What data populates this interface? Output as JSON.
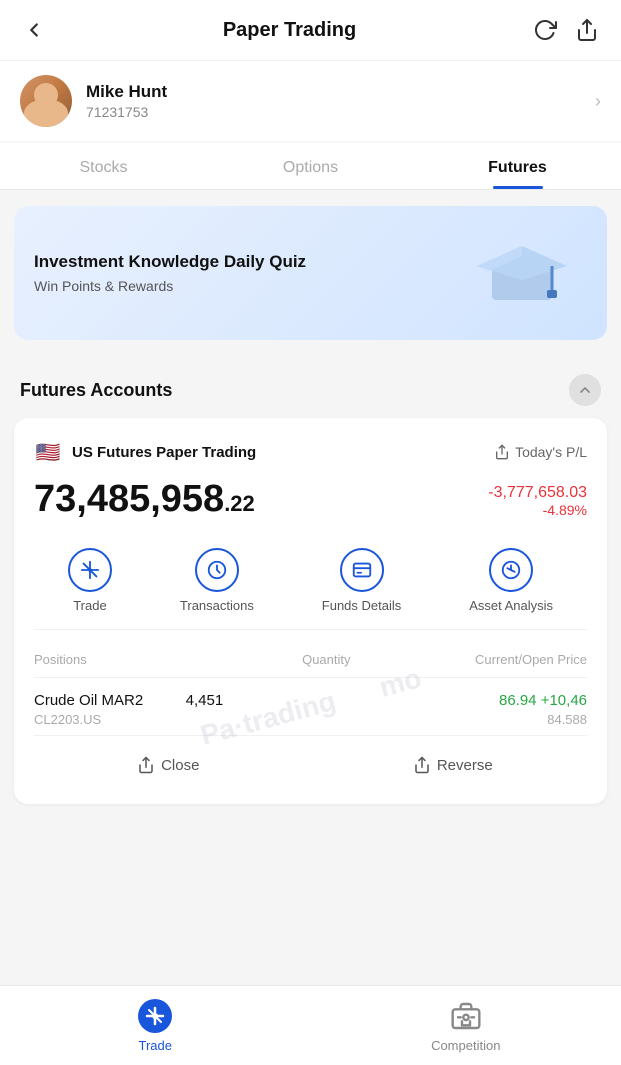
{
  "header": {
    "title": "Paper Trading",
    "back_label": "back"
  },
  "user": {
    "name": "Mike Hunt",
    "id": "71231753"
  },
  "tabs": [
    {
      "label": "Stocks",
      "active": false
    },
    {
      "label": "Options",
      "active": false
    },
    {
      "label": "Futures",
      "active": true
    }
  ],
  "quiz_banner": {
    "title": "Investment Knowledge Daily Quiz",
    "subtitle": "Win Points & Rewards"
  },
  "section": {
    "title": "Futures Accounts"
  },
  "account": {
    "name": "US Futures Paper Trading",
    "pl_label": "Today's P/L",
    "balance_integer": "73,485,958",
    "balance_decimal": ".22",
    "change_amount": "-3,777,658.03",
    "change_pct": "-4.89%",
    "actions": [
      {
        "label": "Trade",
        "icon": "trade-icon"
      },
      {
        "label": "Transactions",
        "icon": "transactions-icon"
      },
      {
        "label": "Funds Details",
        "icon": "funds-icon"
      },
      {
        "label": "Asset Analysis",
        "icon": "analysis-icon"
      }
    ],
    "table": {
      "headers": [
        "Positions",
        "Quantity",
        "Current/Open Price"
      ],
      "rows": [
        {
          "name": "Crude Oil MAR2",
          "code": "CL2203.US",
          "quantity": "4,451",
          "current_price": "86.94",
          "change": "+10,46",
          "open_price": "84.588"
        }
      ]
    },
    "card_actions": [
      {
        "label": "Close",
        "icon": "close-icon"
      },
      {
        "label": "Reverse",
        "icon": "reverse-icon"
      }
    ],
    "watermark": "Pa·trading mo"
  },
  "bottom_nav": [
    {
      "label": "Trade",
      "active": true,
      "icon": "trade-nav-icon"
    },
    {
      "label": "Competition",
      "active": false,
      "icon": "competition-nav-icon"
    }
  ]
}
